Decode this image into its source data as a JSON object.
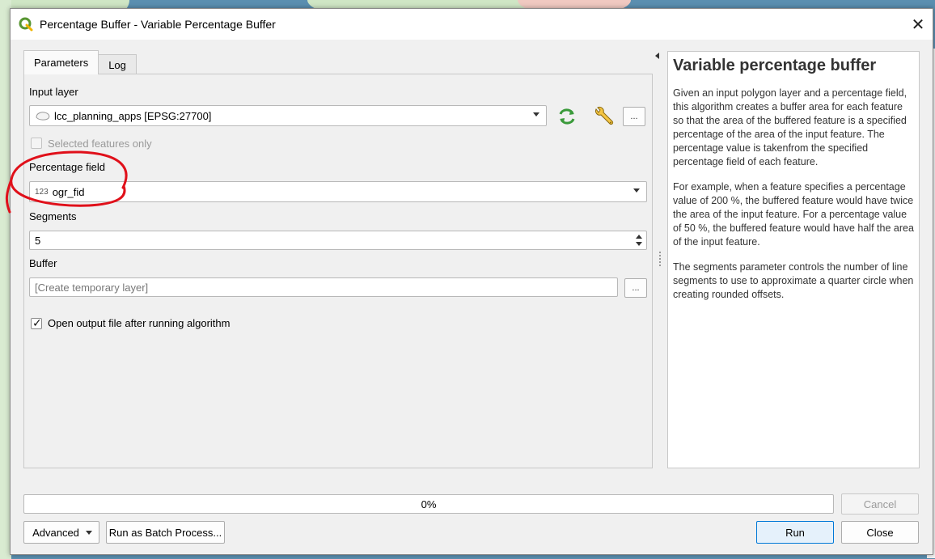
{
  "window": {
    "title": "Percentage Buffer - Variable Percentage Buffer"
  },
  "tabs": [
    {
      "label": "Parameters"
    },
    {
      "label": "Log"
    }
  ],
  "params": {
    "input_layer": {
      "label": "Input layer",
      "value": "lcc_planning_apps [EPSG:27700]",
      "selected_features_only": "Selected features only"
    },
    "percentage_field": {
      "label": "Percentage field",
      "type_prefix": "123",
      "value": "ogr_fid"
    },
    "segments": {
      "label": "Segments",
      "value": "5"
    },
    "buffer": {
      "label": "Buffer",
      "placeholder": "[Create temporary layer]"
    },
    "open_output": {
      "label": "Open output file after running algorithm",
      "checked": true
    },
    "browse_label": "..."
  },
  "help": {
    "title": "Variable percentage buffer",
    "paragraphs": [
      "Given an input polygon layer and a percentage field, this algorithm creates a buffer area for each feature so that the area of the buffered feature is a specified percentage of the area of the input feature. The percentage value is takenfrom the specified percentage field of each feature.",
      "For example, when a feature specifies a percentage value of 200 %, the buffered feature would have twice the area of the input feature. For a percentage value of 50 %, the buffered feature would have half the area of the input feature.",
      "The segments parameter controls the number of line segments to use to approximate a quarter circle when creating rounded offsets."
    ]
  },
  "footer": {
    "progress_text": "0%",
    "progress_value": 0,
    "advanced_label": "Advanced",
    "batch_label": "Run as Batch Process...",
    "cancel_label": "Cancel",
    "run_label": "Run",
    "close_label": "Close"
  },
  "colors": {
    "annotation": "#e0101a",
    "qgis_green": "#589632",
    "refresh_green": "#3a9a3a"
  }
}
